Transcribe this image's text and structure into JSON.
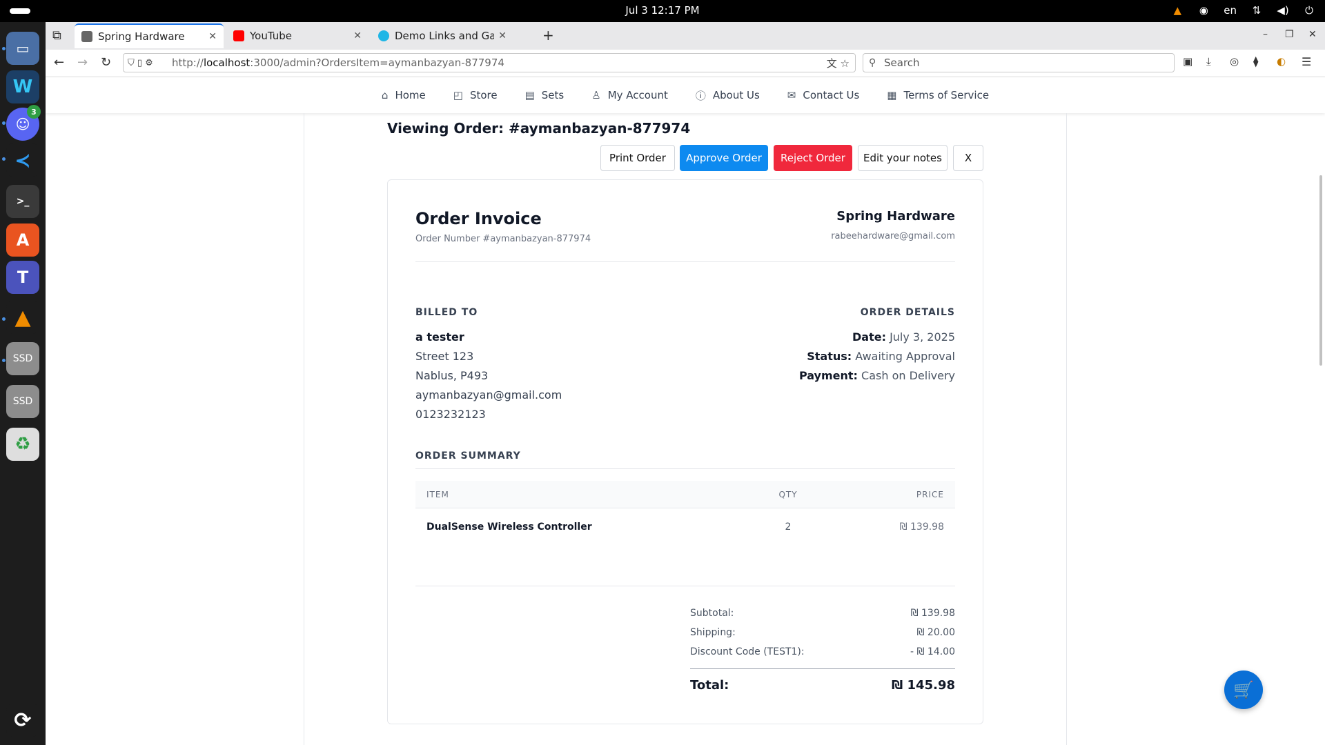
{
  "system": {
    "clock": "Jul 3  12:17 PM",
    "language": "en",
    "discord_badge": "3",
    "dock_labels": {
      "ssd1": "SSD",
      "ssd2": "SSD"
    }
  },
  "browser": {
    "tabs": [
      {
        "title": "Spring Hardware",
        "favicon_color": "#666666"
      },
      {
        "title": "YouTube",
        "favicon_color": "#ff0000"
      },
      {
        "title": "Demo Links and Gallery |",
        "favicon_color": "#1fb6e6"
      }
    ],
    "url": {
      "prefix": "http://",
      "host": "localhost",
      "rest": ":3000/admin?OrdersItem=aymanbazyan-877974"
    },
    "search_placeholder": "Search"
  },
  "site": {
    "nav": [
      {
        "label": "Home",
        "icon": "home-icon"
      },
      {
        "label": "Store",
        "icon": "bag-icon"
      },
      {
        "label": "Sets",
        "icon": "bookmark-icon"
      },
      {
        "label": "My Account",
        "icon": "user-icon"
      },
      {
        "label": "About Us",
        "icon": "info-icon"
      },
      {
        "label": "Contact Us",
        "icon": "mail-icon"
      },
      {
        "label": "Terms of Service",
        "icon": "document-icon"
      }
    ],
    "page_title": "Viewing Order: #aymanbazyan-877974",
    "actions": {
      "print": "Print Order",
      "approve": "Approve Order",
      "reject": "Reject Order",
      "notes": "Edit your notes",
      "close": "X"
    },
    "invoice": {
      "title": "Order Invoice",
      "order_number": "Order Number #aymanbazyan-877974",
      "store_name": "Spring Hardware",
      "store_email": "rabeehardware@gmail.com",
      "billed_to_heading": "BILLED TO",
      "billed_to": [
        "a tester",
        "Street 123",
        "Nablus, P493",
        "aymanbazyan@gmail.com",
        "0123232123"
      ],
      "details_heading": "ORDER DETAILS",
      "details": [
        {
          "label": "Date:",
          "value": "July 3, 2025"
        },
        {
          "label": "Status:",
          "value": "Awaiting Approval"
        },
        {
          "label": "Payment:",
          "value": "Cash on Delivery"
        }
      ],
      "summary_heading": "ORDER SUMMARY",
      "columns": [
        "ITEM",
        "QTY",
        "PRICE"
      ],
      "items": [
        {
          "name": "DualSense Wireless Controller",
          "qty": "2",
          "price": "₪ 139.98"
        }
      ],
      "totals": {
        "subtotal_label": "Subtotal:",
        "subtotal": "₪ 139.98",
        "shipping_label": "Shipping:",
        "shipping": "₪ 20.00",
        "discount_label": "Discount Code (TEST1):",
        "discount": "- ₪ 14.00",
        "total_label": "Total:",
        "total": "₪ 145.98"
      }
    }
  },
  "colors": {
    "primary": "#0d8af0",
    "danger": "#f0283c",
    "cart": "#0a6fd6"
  }
}
